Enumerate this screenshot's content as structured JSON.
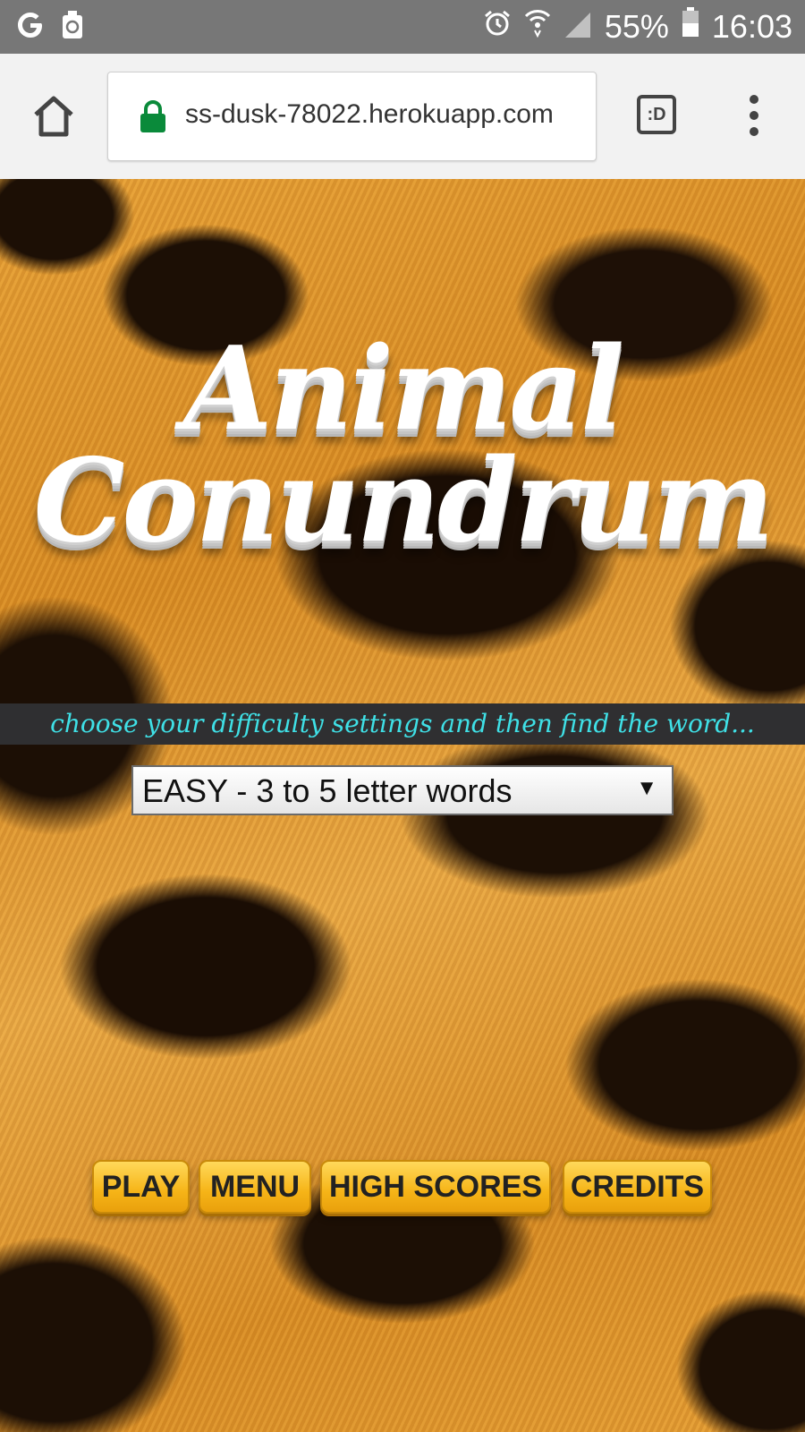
{
  "status_bar": {
    "battery": "55%",
    "time": "16:03",
    "icons": [
      "google-icon",
      "recycle-icon",
      "alarm-icon",
      "wifi-icon",
      "signal-icon",
      "battery-icon"
    ]
  },
  "browser": {
    "url": "ss-dusk-78022.herokuapp.com",
    "tabs_label": ":D",
    "lock_color": "#0a8a3a"
  },
  "game": {
    "title_line1": "Animal",
    "title_line2": "Conundrum",
    "tagline": "choose your difficulty settings and then find the word...",
    "difficulty": {
      "selected": "EASY - 3 to 5 letter words",
      "arrow": "▼"
    },
    "buttons": {
      "play": "PLAY",
      "menu": "MENU",
      "high_scores": "HIGH SCORES",
      "credits": "CREDITS"
    },
    "colors": {
      "tagline": "#3fe0e6",
      "button": "#f6b417",
      "tagline_band": "#2f2f31"
    }
  }
}
